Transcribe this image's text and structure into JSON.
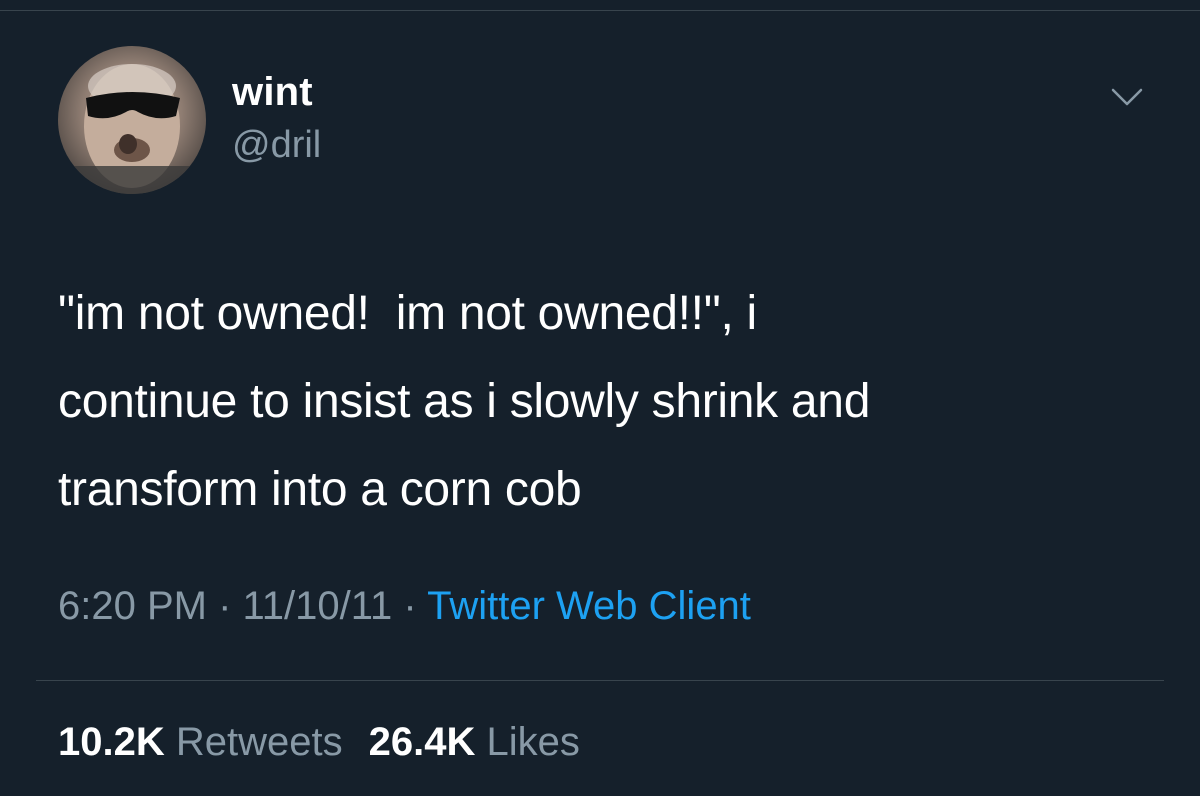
{
  "tweet": {
    "author": {
      "display_name": "wint",
      "handle": "@dril"
    },
    "text_lines": [
      "\"im not owned!  im not owned!!\", i",
      "continue to insist as i slowly shrink and",
      "transform into a corn cob"
    ],
    "time": "6:20 PM",
    "separator": " · ",
    "date": "11/10/11",
    "source": "Twitter Web Client",
    "stats": {
      "retweets_count": "10.2K",
      "retweets_label": "Retweets",
      "likes_count": "26.4K",
      "likes_label": "Likes"
    }
  },
  "icons": {
    "menu": "chevron-down-icon",
    "avatar": "profile-avatar"
  },
  "colors": {
    "background": "#15202b",
    "primary_text": "#ffffff",
    "secondary_text": "#8899a6",
    "link": "#1da1f2",
    "divider": "#38444d"
  }
}
